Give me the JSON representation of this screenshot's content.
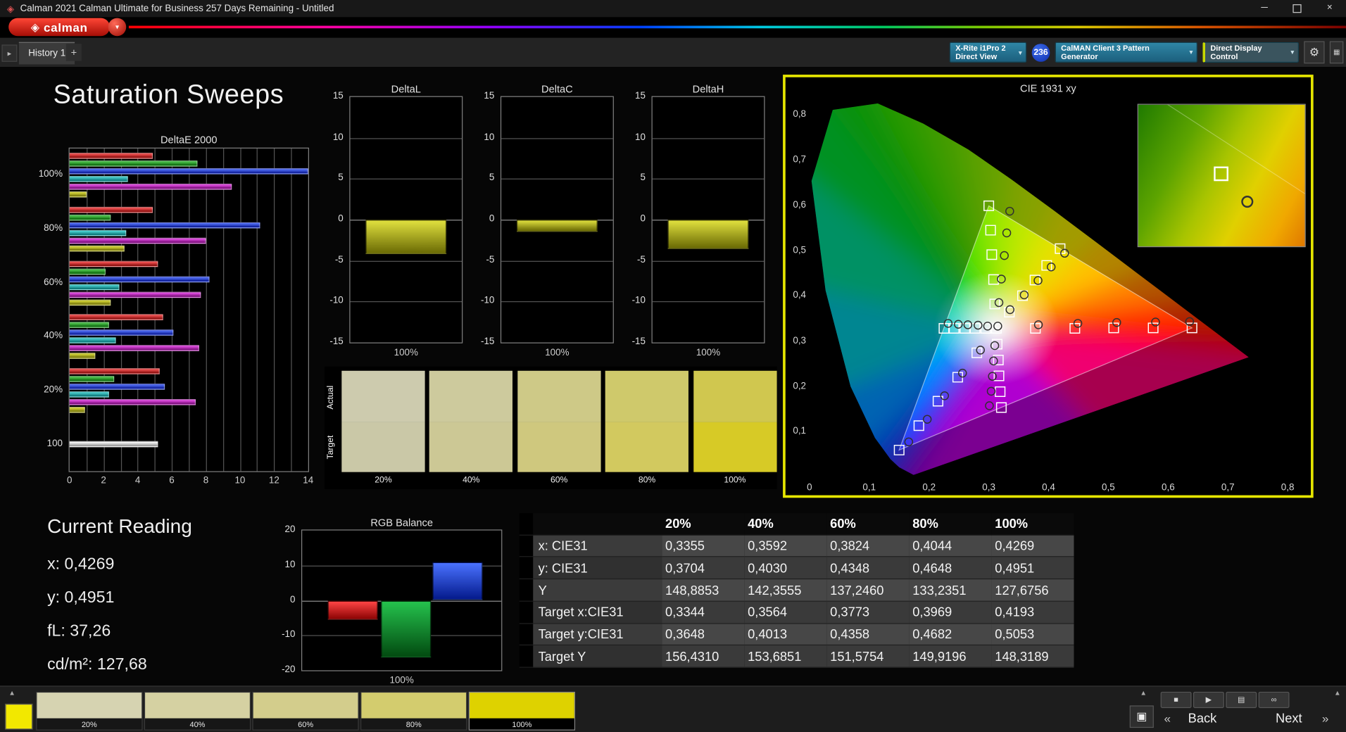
{
  "window": {
    "title": "Calman 2021 Calman Ultimate for Business 257 Days Remaining - Untitled"
  },
  "brand": {
    "logo_text": "calman"
  },
  "tabs": {
    "history": "History 1",
    "add": "+"
  },
  "meter": {
    "device_line1": "X-Rite i1Pro 2",
    "device_line2": "Direct View",
    "badge": "236",
    "pattern_generator": "CalMAN Client 3 Pattern Generator",
    "display_control": "Direct Display Control"
  },
  "page": {
    "title": "Saturation Sweeps"
  },
  "current_reading": {
    "heading": "Current Reading",
    "x_line": "x: 0,4269",
    "y_line": "y: 0,4951",
    "fl_line": "fL: 37,26",
    "cd_line": "cd/m²: 127,68"
  },
  "swatch_panel": {
    "row_labels": [
      "Actual",
      "Target"
    ],
    "columns": [
      {
        "label": "20%",
        "actual": "#cdcbae",
        "target": "#cac8a7"
      },
      {
        "label": "40%",
        "actual": "#cdca9d",
        "target": "#ccc895"
      },
      {
        "label": "60%",
        "actual": "#cec987",
        "target": "#cfc87e"
      },
      {
        "label": "80%",
        "actual": "#cfc96b",
        "target": "#d2c95f"
      },
      {
        "label": "100%",
        "actual": "#d0c74f",
        "target": "#d7ca26"
      }
    ]
  },
  "bottom": {
    "current_patch_color": "#f2e800",
    "patches": [
      {
        "label": "20%",
        "color": "#d6d3b1",
        "selected": false
      },
      {
        "label": "40%",
        "color": "#d5d1a2",
        "selected": false
      },
      {
        "label": "60%",
        "color": "#d3cd8c",
        "selected": false
      },
      {
        "label": "80%",
        "color": "#d3cc6e",
        "selected": false
      },
      {
        "label": "100%",
        "color": "#ded200",
        "selected": true
      }
    ],
    "back_label": "Back",
    "next_label": "Next"
  },
  "icons": {
    "app": "◈",
    "logo_dropdown": "▾",
    "tab_scroll": "▸",
    "chevron_down": "▼",
    "gear": "⚙",
    "layout": "▦",
    "stop": "■",
    "play": "▶",
    "save": "▤",
    "loop": "∞",
    "up_chevron": "▲",
    "window_box": "▣",
    "back_chevrons": "«",
    "next_chevrons": "»",
    "close": "×",
    "minimize": "─"
  },
  "chart_data": [
    {
      "id": "deltaE",
      "type": "bar",
      "orientation": "horizontal",
      "title": "DeltaE 2000",
      "xlim": [
        0,
        14
      ],
      "x_ticks": [
        0,
        2,
        4,
        6,
        8,
        10,
        12,
        14
      ],
      "categories": [
        "100%",
        "80%",
        "60%",
        "40%",
        "20%",
        "100"
      ],
      "groups": [
        {
          "label": "100%",
          "colors": [
            "red",
            "green",
            "blue",
            "cyan",
            "magenta",
            "yellow"
          ],
          "values": [
            4.9,
            7.5,
            14.0,
            3.4,
            9.5,
            1.0
          ]
        },
        {
          "label": "80%",
          "colors": [
            "red",
            "green",
            "blue",
            "cyan",
            "magenta",
            "yellow"
          ],
          "values": [
            4.9,
            2.4,
            11.2,
            3.3,
            8.0,
            3.2
          ]
        },
        {
          "label": "60%",
          "colors": [
            "red",
            "green",
            "blue",
            "cyan",
            "magenta",
            "yellow"
          ],
          "values": [
            5.2,
            2.1,
            8.2,
            2.9,
            7.7,
            2.4
          ]
        },
        {
          "label": "40%",
          "colors": [
            "red",
            "green",
            "blue",
            "cyan",
            "magenta",
            "yellow"
          ],
          "values": [
            5.5,
            2.3,
            6.1,
            2.7,
            7.6,
            1.5
          ]
        },
        {
          "label": "20%",
          "colors": [
            "red",
            "green",
            "blue",
            "cyan",
            "magenta",
            "yellow"
          ],
          "values": [
            5.3,
            2.6,
            5.6,
            2.3,
            7.4,
            0.9
          ]
        },
        {
          "label": "100",
          "colors": [
            "white"
          ],
          "values": [
            5.2
          ]
        }
      ]
    },
    {
      "id": "deltaL",
      "type": "bar",
      "title": "DeltaL",
      "ylim": [
        -15,
        15
      ],
      "y_step": 5,
      "categories": [
        "100%"
      ],
      "values": [
        -4.2
      ],
      "colors": [
        "yellow"
      ],
      "xlabel": "100%"
    },
    {
      "id": "deltaC",
      "type": "bar",
      "title": "DeltaC",
      "ylim": [
        -15,
        15
      ],
      "y_step": 5,
      "categories": [
        "100%"
      ],
      "values": [
        -1.5
      ],
      "colors": [
        "yellow"
      ],
      "xlabel": "100%"
    },
    {
      "id": "deltaH",
      "type": "bar",
      "title": "DeltaH",
      "ylim": [
        -15,
        15
      ],
      "y_step": 5,
      "categories": [
        "100%"
      ],
      "values": [
        -3.6
      ],
      "colors": [
        "yellow"
      ],
      "xlabel": "100%"
    },
    {
      "id": "cie",
      "type": "scatter",
      "title": "CIE 1931 xy",
      "xlim": [
        0,
        0.8
      ],
      "ylim": [
        0,
        0.85
      ],
      "x_ticks": [
        "0",
        "0,1",
        "0,2",
        "0,3",
        "0,4",
        "0,5",
        "0,6",
        "0,7",
        "0,8"
      ],
      "y_ticks": [
        "0,1",
        "0,2",
        "0,3",
        "0,4",
        "0,5",
        "0,6",
        "0,7",
        "0,8"
      ],
      "white_point": [
        0.3127,
        0.329
      ],
      "gamut_triangle": [
        [
          0.64,
          0.33
        ],
        [
          0.3,
          0.6
        ],
        [
          0.15,
          0.06
        ]
      ],
      "targets": [
        [
          0.3127,
          0.329
        ],
        [
          0.378,
          0.329
        ],
        [
          0.444,
          0.329
        ],
        [
          0.509,
          0.33
        ],
        [
          0.575,
          0.33
        ],
        [
          0.64,
          0.33
        ],
        [
          0.31,
          0.383
        ],
        [
          0.308,
          0.437
        ],
        [
          0.305,
          0.492
        ],
        [
          0.303,
          0.546
        ],
        [
          0.3,
          0.6
        ],
        [
          0.28,
          0.275
        ],
        [
          0.248,
          0.221
        ],
        [
          0.215,
          0.168
        ],
        [
          0.183,
          0.114
        ],
        [
          0.15,
          0.06
        ],
        [
          0.295,
          0.329
        ],
        [
          0.277,
          0.329
        ],
        [
          0.26,
          0.329
        ],
        [
          0.242,
          0.329
        ],
        [
          0.225,
          0.329
        ],
        [
          0.314,
          0.294
        ],
        [
          0.316,
          0.259
        ],
        [
          0.317,
          0.224
        ],
        [
          0.319,
          0.189
        ],
        [
          0.321,
          0.154
        ],
        [
          0.3344,
          0.3648
        ],
        [
          0.3564,
          0.4013
        ],
        [
          0.3773,
          0.4358
        ],
        [
          0.3969,
          0.4682
        ],
        [
          0.4193,
          0.5053
        ]
      ],
      "measurements": [
        [
          0.315,
          0.334
        ],
        [
          0.383,
          0.337
        ],
        [
          0.449,
          0.34
        ],
        [
          0.514,
          0.342
        ],
        [
          0.579,
          0.343
        ],
        [
          0.636,
          0.344
        ],
        [
          0.317,
          0.386
        ],
        [
          0.321,
          0.438
        ],
        [
          0.326,
          0.49
        ],
        [
          0.33,
          0.54
        ],
        [
          0.335,
          0.588
        ],
        [
          0.286,
          0.281
        ],
        [
          0.256,
          0.23
        ],
        [
          0.226,
          0.18
        ],
        [
          0.197,
          0.128
        ],
        [
          0.166,
          0.078
        ],
        [
          0.298,
          0.334
        ],
        [
          0.282,
          0.336
        ],
        [
          0.265,
          0.337
        ],
        [
          0.249,
          0.338
        ],
        [
          0.232,
          0.34
        ],
        [
          0.31,
          0.291
        ],
        [
          0.308,
          0.257
        ],
        [
          0.306,
          0.223
        ],
        [
          0.304,
          0.19
        ],
        [
          0.301,
          0.158
        ],
        [
          0.3355,
          0.3704
        ],
        [
          0.3592,
          0.403
        ],
        [
          0.3824,
          0.4348
        ],
        [
          0.4044,
          0.4648
        ],
        [
          0.4269,
          0.4951
        ]
      ]
    },
    {
      "id": "rgb",
      "type": "bar",
      "title": "RGB Balance",
      "ylim": [
        -20,
        20
      ],
      "y_step": 10,
      "categories": [
        "Red",
        "Green",
        "Blue"
      ],
      "values": [
        -5.4,
        -16.4,
        11.0
      ],
      "colors": [
        "rgb_red",
        "rgb_green",
        "rgb_blue"
      ],
      "xlabel": "100%"
    },
    {
      "id": "table",
      "type": "table",
      "header": [
        "",
        "",
        "20%",
        "40%",
        "60%",
        "80%",
        "100%"
      ],
      "rows": [
        [
          "x: CIE31",
          "0,3355",
          "0,3592",
          "0,3824",
          "0,4044",
          "0,4269"
        ],
        [
          "y: CIE31",
          "0,3704",
          "0,4030",
          "0,4348",
          "0,4648",
          "0,4951"
        ],
        [
          "Y",
          "148,8853",
          "142,3555",
          "137,2460",
          "133,2351",
          "127,6756"
        ],
        [
          "Target x:CIE31",
          "0,3344",
          "0,3564",
          "0,3773",
          "0,3969",
          "0,4193"
        ],
        [
          "Target y:CIE31",
          "0,3648",
          "0,4013",
          "0,4358",
          "0,4682",
          "0,5053"
        ],
        [
          "Target Y",
          "156,4310",
          "153,6851",
          "151,5754",
          "149,9196",
          "148,3189"
        ]
      ]
    }
  ]
}
